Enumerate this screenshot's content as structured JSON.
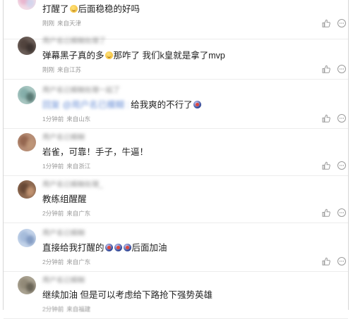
{
  "comments": [
    {
      "text": "打醒了后面稳稳的好吗",
      "time": "刚刚",
      "location": "来自天津",
      "avatar_colors": [
        "#e6a9c6",
        "#c7d3ef"
      ],
      "emoji": "grin"
    },
    {
      "username": "用户名已模糊处理了",
      "text": "弹幕黑子真的多那咋了 我们k皇就是拿了mvp",
      "time": "刚刚",
      "location": "来自江苏",
      "avatar_colors": [
        "#4a3c36",
        "#2c2422"
      ],
      "emoji": "grin"
    },
    {
      "username": "用户名已模糊处理一起了",
      "mention": "回复 @用户名已模糊 :",
      "text": "给我爽的不行了",
      "time": "1分钟前",
      "location": "来自山东",
      "avatar_colors": [
        "#7aa7a3",
        "#3a5a54"
      ],
      "emoji": "ball"
    },
    {
      "username": "用户名已模糊",
      "text": "岩雀，可靠！手子，牛逼！",
      "time": "1分钟前",
      "location": "来自浙江",
      "avatar_colors": [
        "#8a5a44",
        "#c29a7a"
      ]
    },
    {
      "username": "用户名已模糊处理_",
      "text": "教练组醒醒",
      "time": "2分钟前",
      "location": "来自广东",
      "avatar_colors": [
        "#5b3e2c",
        "#d6a47e"
      ]
    },
    {
      "username": "用户名已模糊",
      "text": "直接给我打醒的后面加油",
      "time": "2分钟前",
      "location": "来自广东",
      "avatar_colors": [
        "#9cb4d6",
        "#6a86b4"
      ],
      "emoji": "ball"
    },
    {
      "username": "用户名已模糊",
      "text": "继续加油 但是可以考虑给下路抢下强势英雄",
      "time": "2分钟前",
      "location": "来自福建",
      "avatar_colors": [
        "#8a8270",
        "#4e4a3e"
      ]
    }
  ],
  "icons": {
    "like": "thumbs-up-icon",
    "more": "message-dots-icon"
  },
  "colors": {
    "meta": "#999999",
    "mention": "#6a8fd6",
    "divider": "#ececec"
  }
}
